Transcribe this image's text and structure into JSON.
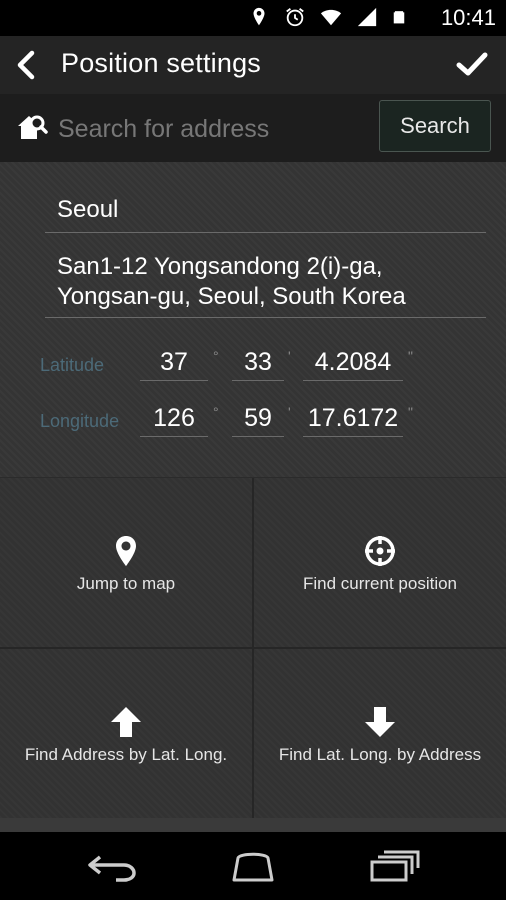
{
  "status_bar": {
    "time": "10:41",
    "icons": [
      "location-icon",
      "alarm-icon",
      "wifi-icon",
      "signal-icon",
      "battery-icon"
    ]
  },
  "action_bar": {
    "title": "Position settings",
    "back_icon": "back-chevron-icon",
    "confirm_icon": "check-icon"
  },
  "search": {
    "placeholder": "Search for address",
    "value": "",
    "button_label": "Search",
    "icon": "home-search-icon"
  },
  "address": {
    "city": "Seoul",
    "full_address_line1": "San1-12 Yongsandong 2(i)-ga,",
    "full_address_line2": "Yongsan-gu, Seoul, South Korea"
  },
  "coordinates": {
    "latitude": {
      "label": "Latitude",
      "degrees": "37",
      "minutes": "33",
      "seconds": "4.2084"
    },
    "longitude": {
      "label": "Longitude",
      "degrees": "126",
      "minutes": "59",
      "seconds": "17.6172"
    },
    "units": {
      "deg": "°",
      "min": "'",
      "sec": "\""
    }
  },
  "actions": [
    {
      "label": "Jump to map",
      "icon": "map-pin-icon"
    },
    {
      "label": "Find current position",
      "icon": "crosshair-icon"
    },
    {
      "label": "Find Address by Lat. Long.",
      "icon": "arrow-up-icon"
    },
    {
      "label": "Find Lat. Long. by Address",
      "icon": "arrow-down-icon"
    }
  ],
  "nav_bar": {
    "icons": [
      "nav-back-icon",
      "nav-home-icon",
      "nav-recent-apps-icon"
    ]
  },
  "colors": {
    "status_bar": "#000000",
    "action_bar": "#242424",
    "search_bar": "#1d1d1d",
    "panel": "#343434",
    "coord_label": "#4c6a78",
    "search_button_bg": "#1b2521"
  }
}
